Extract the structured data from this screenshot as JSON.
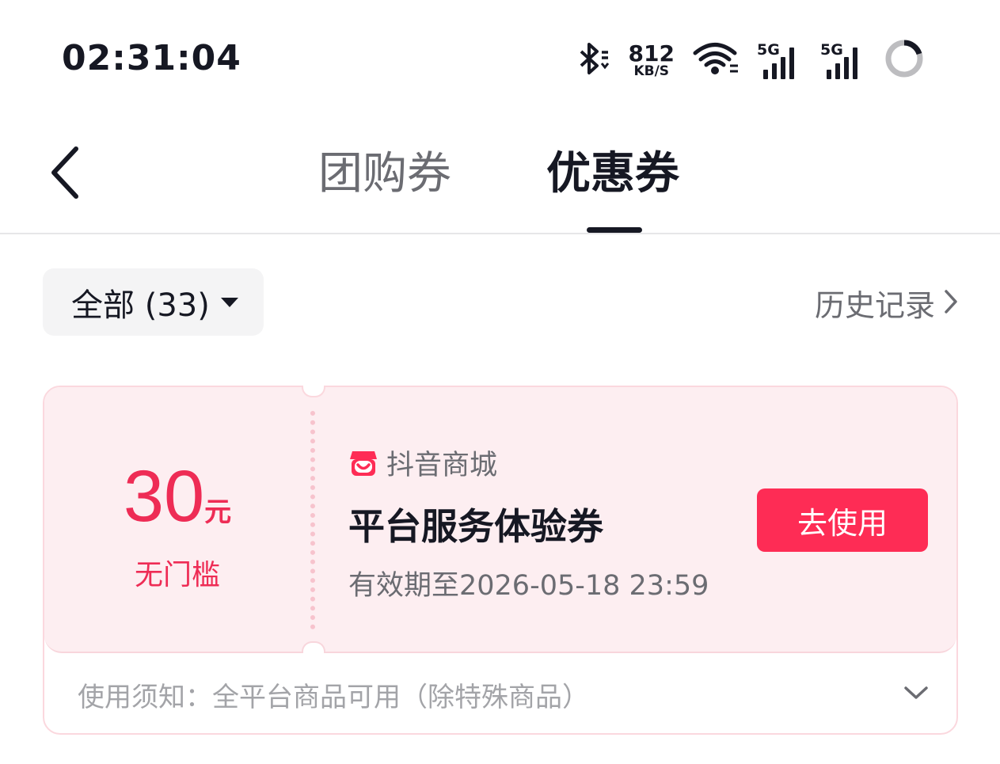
{
  "status_bar": {
    "time": "02:31:04",
    "net_speed_value": "812",
    "net_speed_unit": "KB/S",
    "sim1_tag": "5G",
    "sim2_tag": "5G",
    "icons": [
      "bluetooth-icon",
      "wifi-icon",
      "signal-5g-icon",
      "signal-5g-icon",
      "battery-ring-icon"
    ]
  },
  "header": {
    "back_icon": "chevron-left-icon",
    "tabs": [
      {
        "label": "团购券",
        "active": false
      },
      {
        "label": "优惠券",
        "active": true
      }
    ]
  },
  "filter": {
    "label": "全部 (33)",
    "caret_icon": "caret-down-icon"
  },
  "history": {
    "label": "历史记录",
    "icon": "chevron-right-icon"
  },
  "coupon": {
    "amount": "30",
    "amount_unit": "元",
    "threshold": "无门槛",
    "shop_name": "抖音商城",
    "shop_icon": "store-icon",
    "title": "平台服务体验券",
    "expiry": "有效期至2026-05-18 23:59",
    "action_label": "去使用",
    "usage_note": "使用须知：全平台商品可用（除特殊商品）",
    "expand_icon": "chevron-down-icon"
  },
  "colors": {
    "accent": "#fe2c55",
    "coupon_bg": "#fdeef1",
    "text_primary": "#161823",
    "text_secondary": "#6b6c72"
  }
}
